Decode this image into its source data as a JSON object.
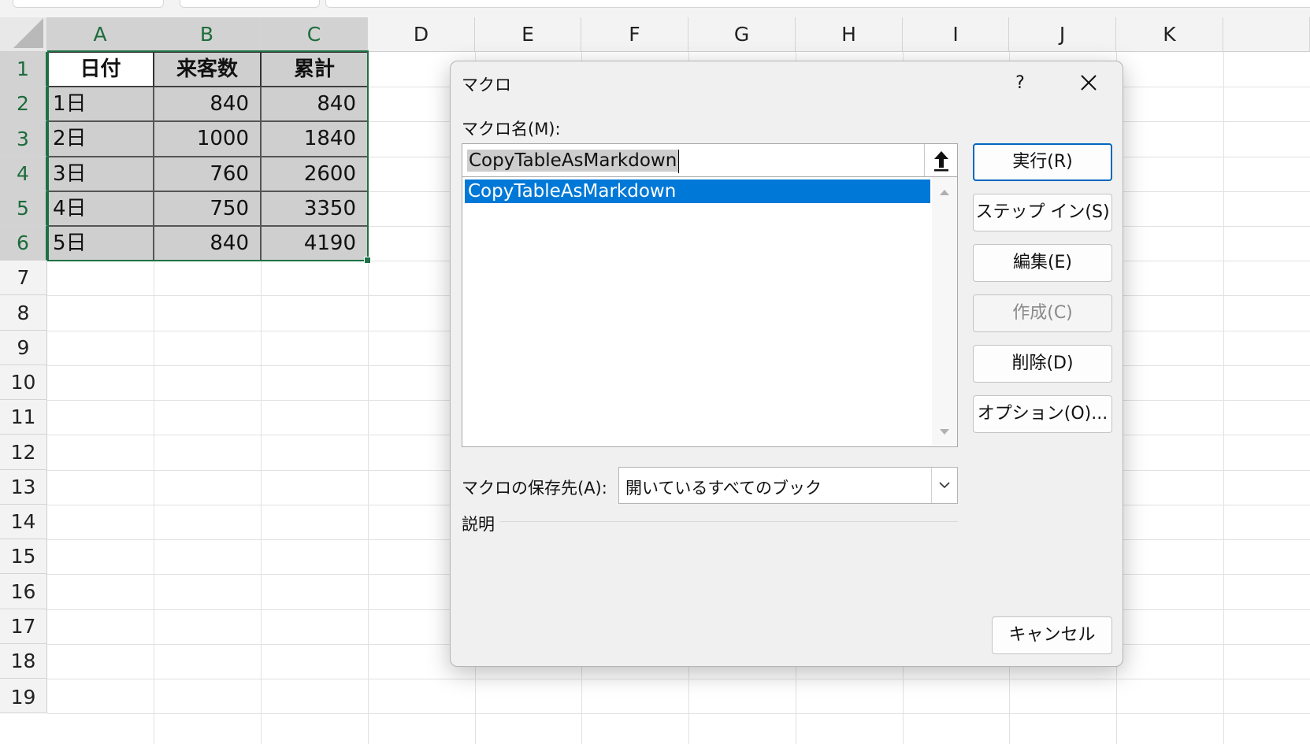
{
  "sheet": {
    "columns": [
      "A",
      "B",
      "C",
      "D",
      "E",
      "F",
      "G",
      "H",
      "I",
      "J",
      "K"
    ],
    "rows": [
      "1",
      "2",
      "3",
      "4",
      "5",
      "6",
      "7",
      "8",
      "9",
      "10",
      "11",
      "12",
      "13",
      "14",
      "15",
      "16",
      "17",
      "18",
      "19"
    ],
    "table": {
      "headers": [
        "日付",
        "来客数",
        "累計"
      ],
      "rows": [
        [
          "1日",
          "840",
          "840"
        ],
        [
          "2日",
          "1000",
          "1840"
        ],
        [
          "3日",
          "760",
          "2600"
        ],
        [
          "4日",
          "750",
          "3350"
        ],
        [
          "5日",
          "840",
          "4190"
        ]
      ]
    },
    "selection_color": "#1e7145"
  },
  "dialog": {
    "title": "マクロ",
    "help": "?",
    "macro_name_label": "マクロ名(M):",
    "macro_name_value": "CopyTableAsMarkdown",
    "macro_list": [
      "CopyTableAsMarkdown"
    ],
    "upload_icon": "upload-arrow-icon",
    "buttons": {
      "run": "実行(R)",
      "step_into": "ステップ イン(S)",
      "edit": "編集(E)",
      "create": "作成(C)",
      "delete": "削除(D)",
      "options": "オプション(O)...",
      "cancel": "キャンセル"
    },
    "store_label": "マクロの保存先(A):",
    "store_value": "開いているすべてのブック",
    "description_label": "説明",
    "selected_color": "#0078d7",
    "primary_border_color": "#0067c0"
  }
}
